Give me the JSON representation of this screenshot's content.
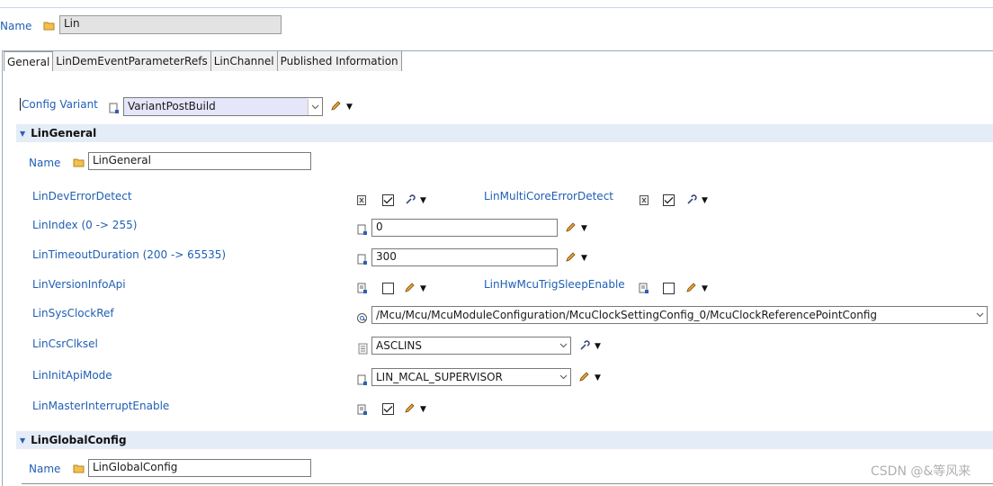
{
  "header": {
    "name_label": "Name",
    "name_value": "Lin"
  },
  "tabs": [
    {
      "label": "General",
      "active": true
    },
    {
      "label": "LinDemEventParameterRefs"
    },
    {
      "label": "LinChannel"
    },
    {
      "label": "Published Information"
    }
  ],
  "config_variant": {
    "label": "Config Variant",
    "value": "VariantPostBuild"
  },
  "lin_general": {
    "title": "LinGeneral",
    "name_label": "Name",
    "name_value": "LinGeneral",
    "params": {
      "dev_error_detect": {
        "label": "LinDevErrorDetect",
        "checked": true
      },
      "multicore_error_detect": {
        "label": "LinMultiCoreErrorDetect",
        "checked": true
      },
      "index": {
        "label": "LinIndex (0 -> 255)",
        "value": "0"
      },
      "timeout_duration": {
        "label": "LinTimeoutDuration (200 -> 65535)",
        "value": "300"
      },
      "version_info_api": {
        "label": "LinVersionInfoApi",
        "checked": false
      },
      "hw_mcu_trig_sleep": {
        "label": "LinHwMcuTrigSleepEnable",
        "checked": false
      },
      "sys_clock_ref": {
        "label": "LinSysClockRef",
        "value": "/Mcu/Mcu/McuModuleConfiguration/McuClockSettingConfig_0/McuClockReferencePointConfig"
      },
      "csr_clksel": {
        "label": "LinCsrClksel",
        "value": "ASCLINS"
      },
      "init_api_mode": {
        "label": "LinInitApiMode",
        "value": "LIN_MCAL_SUPERVISOR"
      },
      "master_interrupt": {
        "label": "LinMasterInterruptEnable",
        "checked": true
      }
    }
  },
  "lin_global_config": {
    "title": "LinGlobalConfig",
    "name_label": "Name",
    "name_value": "LinGlobalConfig"
  },
  "watermark": "CSDN @&等风来",
  "colors": {
    "label_blue": "#1f5fb5",
    "section_bg": "#e4ecf7",
    "variant_bg": "#e6e6fa"
  }
}
